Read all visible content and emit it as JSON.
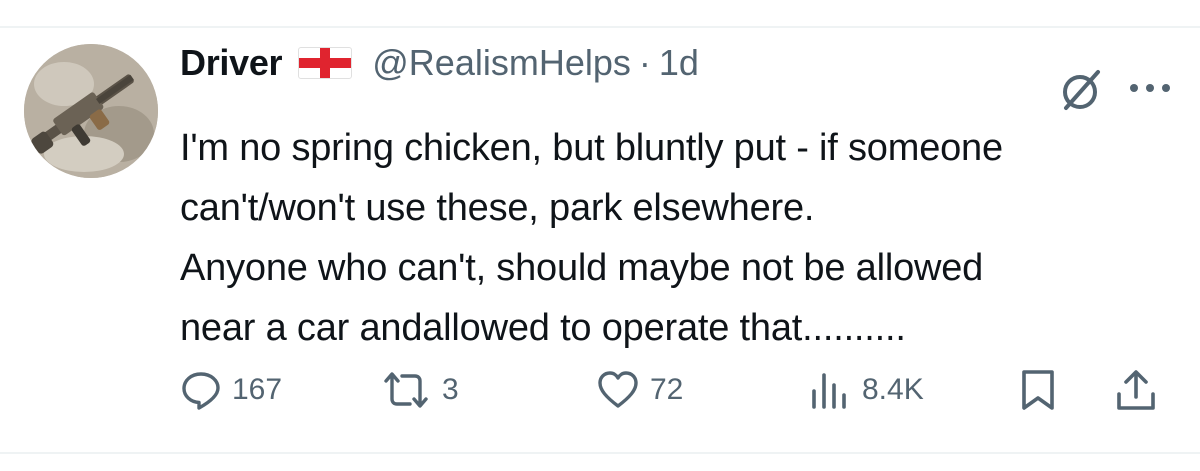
{
  "tweet": {
    "display_name": "Driver",
    "flag_emoji": "🏴",
    "handle": "@RealismHelps",
    "separator": "·",
    "time": "1d",
    "text_lines": [
      "I'm no spring chicken, but bluntly put - if someone",
      "can't/won't use these, park elsewhere.",
      "Anyone who can't, should maybe not be allowed",
      "near a car andallowed to operate that.........."
    ]
  },
  "actions": {
    "reply_count": "167",
    "repost_count": "3",
    "like_count": "72",
    "views_count": "8.4K"
  },
  "icons": {
    "avatar": "avatar-rifle-photo",
    "grok": "grok-icon",
    "more": "more-icon",
    "reply": "reply-icon",
    "repost": "repost-icon",
    "like": "heart-icon",
    "views": "views-icon",
    "bookmark": "bookmark-icon",
    "share": "share-icon"
  },
  "colors": {
    "text": "#0f1419",
    "secondary": "#536471",
    "flag_red": "#e0242f",
    "divider": "#eff3f4"
  }
}
